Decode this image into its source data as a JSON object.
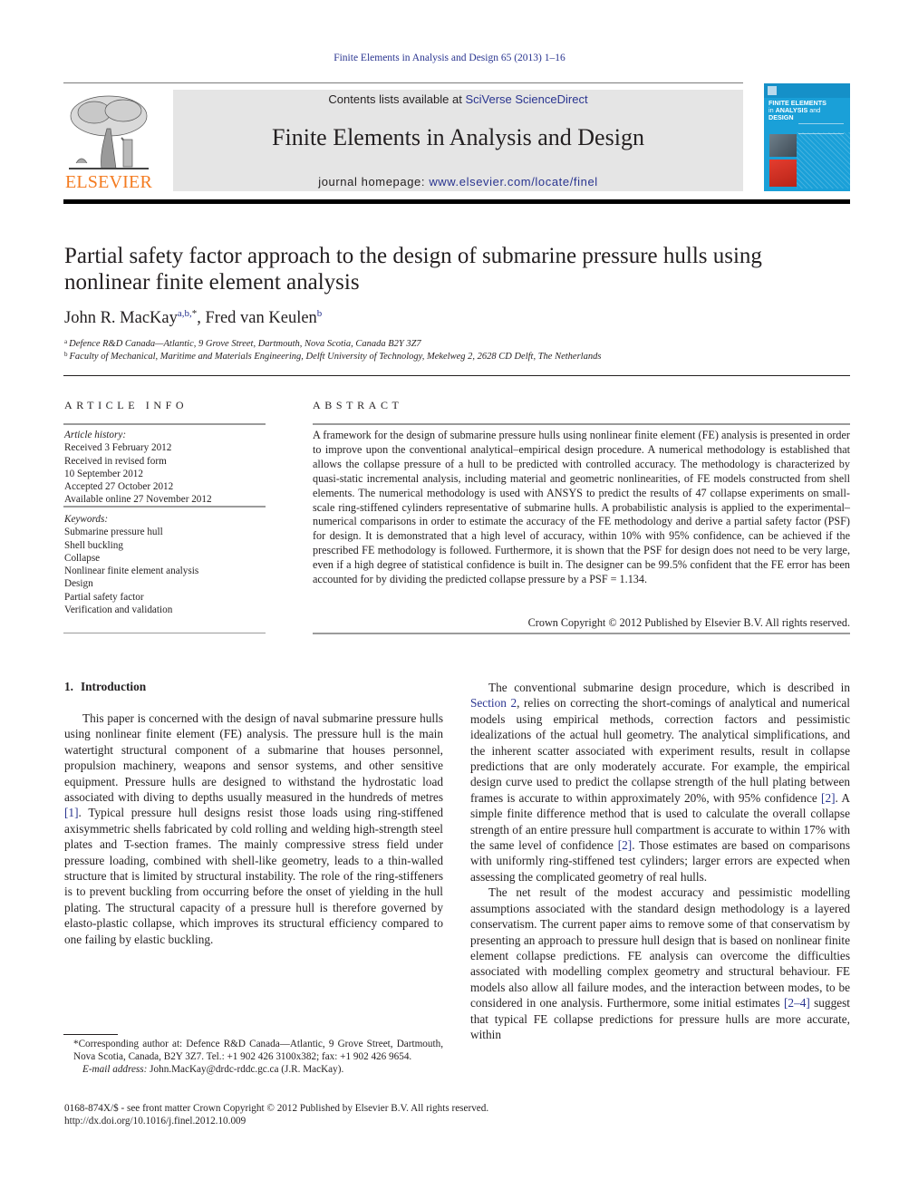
{
  "running_head": "Finite Elements in Analysis and Design 65 (2013) 1–16",
  "masthead": {
    "publisher_logo_text": "ELSEVIER",
    "contents_prefix": "Contents lists available at ",
    "contents_link": "SciVerse ScienceDirect",
    "journal_title": "Finite Elements in Analysis and Design",
    "homepage_prefix": "journal homepage: ",
    "homepage_link": "www.elsevier.com/locate/finel",
    "cover": {
      "line1": "FINITE ELEMENTS",
      "line2a": "in ",
      "line2b": "ANALYSIS",
      "line2c": " and",
      "line3": "DESIGN"
    }
  },
  "colors": {
    "link": "#2a3590",
    "elsevier_orange": "#f47b20",
    "masthead_gray": "#e5e5e5",
    "cover_blue": "#1aa0d8"
  },
  "article": {
    "title_line1": "Partial safety factor approach to the design of submarine pressure hulls using",
    "title_line2": "nonlinear finite element analysis",
    "authors": [
      {
        "name": "John R. MacKay",
        "sup": "a,b,",
        "star": "*"
      },
      {
        "name": "Fred van Keulen",
        "sup": "b"
      }
    ],
    "author_sep": ", ",
    "affiliations": [
      {
        "key": "a",
        "text": "Defence R&D Canada—Atlantic, 9 Grove Street, Dartmouth, Nova Scotia, Canada B2Y 3Z7"
      },
      {
        "key": "b",
        "text": "Faculty of Mechanical, Maritime and Materials Engineering, Delft University of Technology, Mekelweg 2, 2628 CD Delft, The Netherlands"
      }
    ]
  },
  "article_info": {
    "heading": "ARTICLE INFO",
    "history_label": "Article history:",
    "history": [
      "Received 3 February 2012",
      "Received in revised form",
      "10 September 2012",
      "Accepted 27 October 2012",
      "Available online 27 November 2012"
    ],
    "keywords_label": "Keywords:",
    "keywords": [
      "Submarine pressure hull",
      "Shell buckling",
      "Collapse",
      "Nonlinear finite element analysis",
      "Design",
      "Partial safety factor",
      "Verification and validation"
    ]
  },
  "abstract": {
    "heading": "ABSTRACT",
    "text": "A framework for the design of submarine pressure hulls using nonlinear finite element (FE) analysis is presented in order to improve upon the conventional analytical–empirical design procedure. A numerical methodology is established that allows the collapse pressure of a hull to be predicted with controlled accuracy. The methodology is characterized by quasi-static incremental analysis, including material and geometric nonlinearities, of FE models constructed from shell elements. The numerical methodology is used with ANSYS to predict the results of 47 collapse experiments on small-scale ring-stiffened cylinders representative of submarine hulls. A probabilistic analysis is applied to the experimental–numerical comparisons in order to estimate the accuracy of the FE methodology and derive a partial safety factor (PSF) for design. It is demonstrated that a high level of accuracy, within 10% with 95% confidence, can be achieved if the prescribed FE methodology is followed. Furthermore, it is shown that the PSF for design does not need to be very large, even if a high degree of statistical confidence is built in. The designer can be 99.5% confident that the FE error has been accounted for by dividing the predicted collapse pressure by a PSF = 1.134.",
    "copyright": "Crown Copyright © 2012 Published by Elsevier B.V. All rights reserved."
  },
  "introduction": {
    "number": "1.",
    "title": "Introduction",
    "p1_a": "This paper is concerned with the design of naval submarine pressure hulls using nonlinear finite element (FE) analysis. The pressure hull is the main watertight structural component of a submarine that houses personnel, propulsion machinery, weapons and sensor systems, and other sensitive equipment. Pressure hulls are designed to withstand the hydrostatic load associated with diving to depths usually measured in the hundreds of metres ",
    "p1_ref1": "[1]",
    "p1_b": ". Typical pressure hull designs resist those loads using ring-stiffened axisymmetric shells fabricated by cold rolling and welding high-strength steel plates and T-section frames. The mainly compressive stress field under pressure loading, combined with shell-like geometry, leads to a thin-walled structure that is limited by structural instability. The role of the ring-stiffeners is to prevent buckling from occurring before the onset of yielding in the hull plating. The structural capacity of a pressure hull is therefore governed by elasto-plastic collapse, which improves its structural efficiency compared to one failing by elastic buckling.",
    "p2_a": "The conventional submarine design procedure, which is described in ",
    "p2_link": "Section 2",
    "p2_b": ", relies on correcting the short-comings of analytical and numerical models using empirical methods, correction factors and pessimistic idealizations of the actual hull geometry. The analytical simplifications, and the inherent scatter associated with experiment results, result in collapse predictions that are only moderately accurate. For example, the empirical design curve used to predict the collapse strength of the hull plating between frames is accurate to within approximately 20%, with 95% confidence ",
    "p2_ref2a": "[2]",
    "p2_c": ". A simple finite difference method that is used to calculate the overall collapse strength of an entire pressure hull compartment is accurate to within 17% with the same level of confidence ",
    "p2_ref2b": "[2]",
    "p2_d": ". Those estimates are based on comparisons with uniformly ring-stiffened test cylinders; larger errors are expected when assessing the complicated geometry of real hulls.",
    "p3_a": "The net result of the modest accuracy and pessimistic modelling assumptions associated with the standard design methodology is a layered conservatism. The current paper aims to remove some of that conservatism by presenting an approach to pressure hull design that is based on nonlinear finite element collapse predictions. FE analysis can overcome the difficulties associated with modelling complex geometry and structural behaviour. FE models also allow all failure modes, and the interaction between modes, to be considered in one analysis. Furthermore, some initial estimates ",
    "p3_ref": "[2–4]",
    "p3_b": " suggest that typical FE collapse predictions for pressure hulls are more accurate, within"
  },
  "footnote": {
    "star": "*",
    "corresponding": "Corresponding author at: Defence R&D Canada—Atlantic, 9 Grove Street, Dartmouth, Nova Scotia, Canada, B2Y 3Z7. Tel.: +1 902 426 3100x382; fax: +1 902 426 9654.",
    "email_label": "E-mail address:",
    "email": " John.MacKay@drdc-rddc.gc.ca (J.R. MacKay)."
  },
  "front_matter": {
    "issn_line": "0168-874X/$ - see front matter Crown Copyright © 2012 Published by Elsevier B.V. All rights reserved.",
    "doi": "http://dx.doi.org/10.1016/j.finel.2012.10.009"
  }
}
